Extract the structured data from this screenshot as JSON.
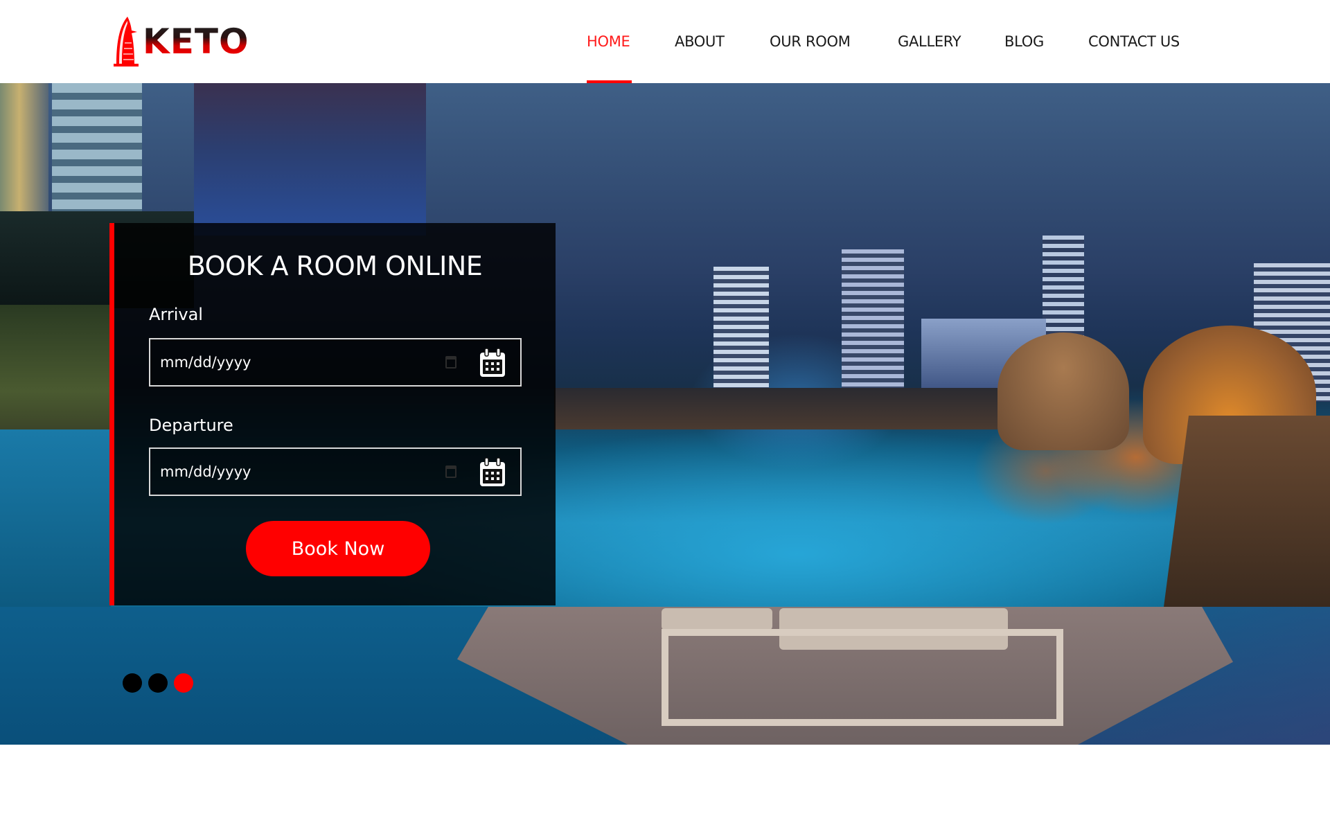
{
  "brand": {
    "name": "KETO",
    "accent_color": "#ff0000"
  },
  "nav": {
    "items": [
      {
        "label": "HOME",
        "active": true
      },
      {
        "label": "ABOUT",
        "active": false
      },
      {
        "label": "OUR ROOM",
        "active": false
      },
      {
        "label": "GALLERY",
        "active": false
      },
      {
        "label": "BLOG",
        "active": false
      },
      {
        "label": "CONTACT US",
        "active": false
      }
    ]
  },
  "booking": {
    "title": "BOOK A ROOM ONLINE",
    "arrival": {
      "label": "Arrival",
      "placeholder": "mm/dd/yyyy",
      "value": "",
      "icon": "calendar-icon"
    },
    "departure": {
      "label": "Departure",
      "placeholder": "mm/dd/yyyy",
      "value": "",
      "icon": "calendar-icon"
    },
    "submit_label": "Book Now"
  },
  "carousel": {
    "slide_count": 3,
    "active_index": 2
  }
}
